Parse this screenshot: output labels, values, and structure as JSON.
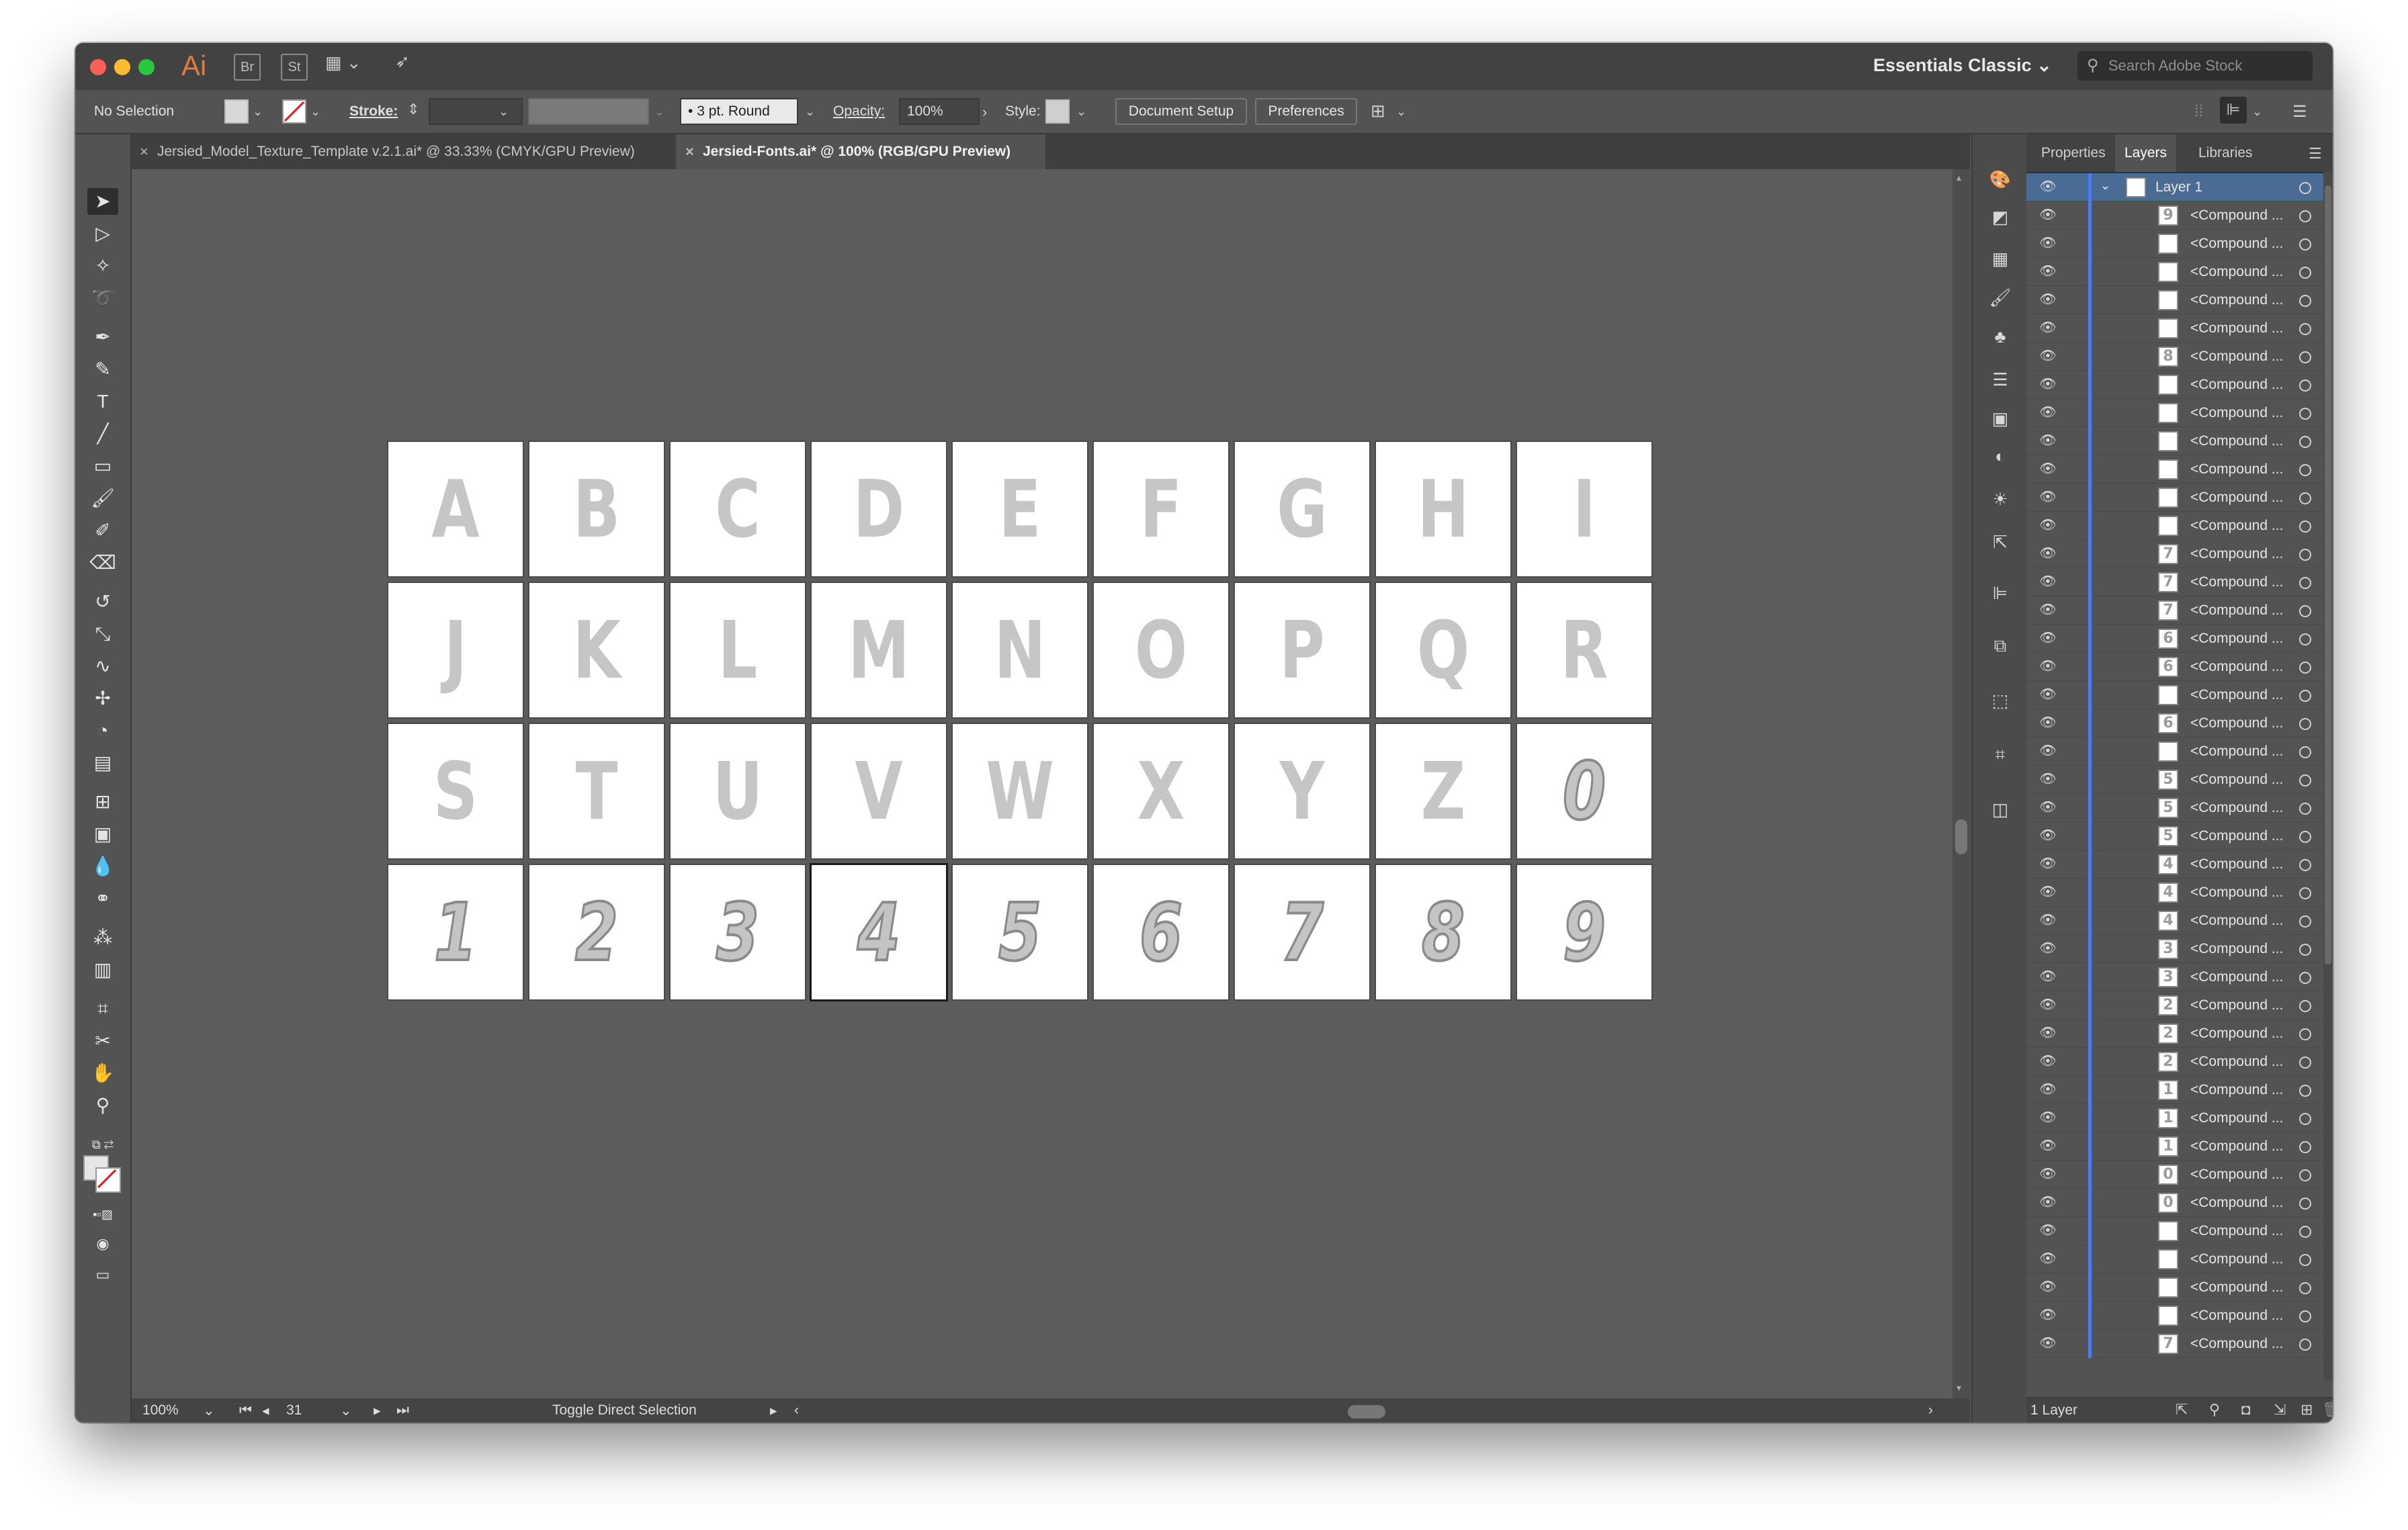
{
  "titlebar": {
    "app": "Ai",
    "bridge": "Br",
    "stock": "St",
    "workspace": "Essentials Classic",
    "search_placeholder": "Search Adobe Stock"
  },
  "control": {
    "selection": "No Selection",
    "stroke_label": "Stroke:",
    "brush": "3 pt. Round",
    "opacity_label": "Opacity:",
    "opacity": "100%",
    "style_label": "Style:",
    "document_setup": "Document Setup",
    "preferences": "Preferences"
  },
  "tabs": [
    {
      "label": "Jersied_Model_Texture_Template v.2.1.ai* @ 33.33% (CMYK/GPU Preview)"
    },
    {
      "label": "Jersied-Fonts.ai* @ 100% (RGB/GPU Preview)"
    }
  ],
  "artboards": {
    "letters": [
      "A",
      "B",
      "C",
      "D",
      "E",
      "F",
      "G",
      "H",
      "I",
      "J",
      "K",
      "L",
      "M",
      "N",
      "O",
      "P",
      "Q",
      "R",
      "S",
      "T",
      "U",
      "V",
      "W",
      "X",
      "Y",
      "Z"
    ],
    "digits": [
      "0",
      "1",
      "2",
      "3",
      "4",
      "5",
      "6",
      "7",
      "8",
      "9"
    ],
    "selected": "4"
  },
  "status": {
    "zoom": "100%",
    "artboard": "31",
    "tool": "Toggle Direct Selection"
  },
  "panel": {
    "tabs": [
      "Properties",
      "Layers",
      "Libraries"
    ],
    "layer_name": "Layer 1",
    "sublayer_label": "<Compound ...",
    "thumbs": [
      "9",
      "",
      "",
      "",
      "",
      "8",
      "",
      "",
      "",
      "",
      "",
      "",
      "7",
      "7",
      "7",
      "6",
      "6",
      "",
      "6",
      "",
      "5",
      "5",
      "5",
      "4",
      "4",
      "4",
      "3",
      "3",
      "2",
      "2",
      "2",
      "1",
      "1",
      "1",
      "0",
      "0",
      "",
      "",
      "",
      "",
      "7"
    ],
    "footer": "1 Layer"
  },
  "colors": {
    "accent": "#4a6b93",
    "layer_color": "#4d7bf0",
    "app_orange": "#e37b3c"
  }
}
